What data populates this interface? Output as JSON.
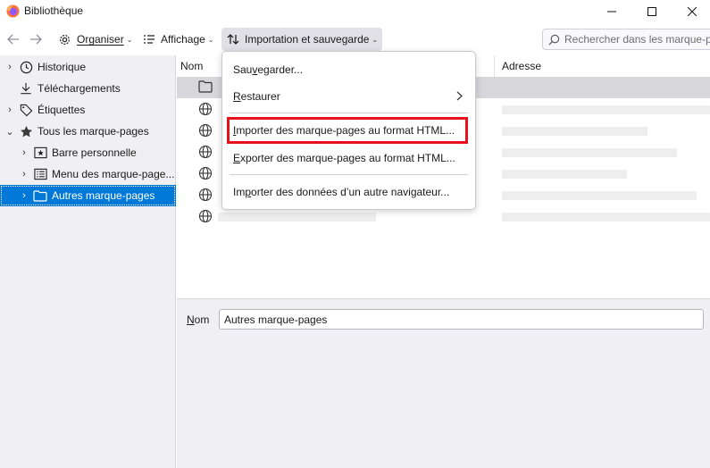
{
  "window": {
    "title": "Bibliothèque",
    "controls": [
      "minimize-icon",
      "maximize-icon",
      "close-icon"
    ]
  },
  "toolbar": {
    "back_icon": "arrow-left-icon",
    "forward_icon": "arrow-right-icon",
    "organize_label": "Organiser",
    "view_label": "Affichage",
    "import_backup_label": "Importation et sauvegarde",
    "search_placeholder": "Rechercher dans les marque-pages"
  },
  "sidebar": {
    "items": [
      {
        "label": "Historique",
        "icon": "clock-icon",
        "twisty": "›"
      },
      {
        "label": "Téléchargements",
        "icon": "download-icon",
        "twisty": ""
      },
      {
        "label": "Étiquettes",
        "icon": "tag-icon",
        "twisty": "›"
      },
      {
        "label": "Tous les marque-pages",
        "icon": "star-icon",
        "twisty": "⌄"
      },
      {
        "label": "Barre personnelle",
        "icon": "bookmarks-toolbar-icon",
        "twisty": "›"
      },
      {
        "label": "Menu des marque-page...",
        "icon": "bookmarks-menu-icon",
        "twisty": "›"
      },
      {
        "label": "Autres marque-pages",
        "icon": "folder-icon",
        "twisty": "›",
        "selected": true
      }
    ]
  },
  "content": {
    "columns": {
      "name": "Nom",
      "address": "Adresse"
    },
    "rows": [
      {
        "icon": "folder-icon",
        "highlighted": true
      },
      {
        "icon": "globe-icon"
      },
      {
        "icon": "globe-icon"
      },
      {
        "icon": "globe-icon"
      },
      {
        "icon": "globe-icon"
      },
      {
        "icon": "globe-icon"
      },
      {
        "icon": "globe-icon"
      }
    ]
  },
  "details": {
    "name_label_prefix": "N",
    "name_label_rest": "om",
    "name_value": "Autres marque-pages"
  },
  "menu": {
    "backup": {
      "pre": "Sau",
      "key": "v",
      "post": "egarder..."
    },
    "restore": {
      "pre": "",
      "key": "R",
      "post": "estaurer"
    },
    "import_html": {
      "pre": "",
      "key": "I",
      "post": "mporter des marque-pages au format HTML..."
    },
    "export_html": {
      "pre": "",
      "key": "E",
      "post": "xporter des marque-pages au format HTML..."
    },
    "import_other": {
      "pre": "Im",
      "key": "p",
      "post": "orter des données d’un autre navigateur..."
    }
  },
  "colors": {
    "selection": "#0078d7",
    "highlight_box": "#e8101a",
    "sidebar_bg": "#f0f0f4",
    "firefox_orange": "#ff7139"
  }
}
